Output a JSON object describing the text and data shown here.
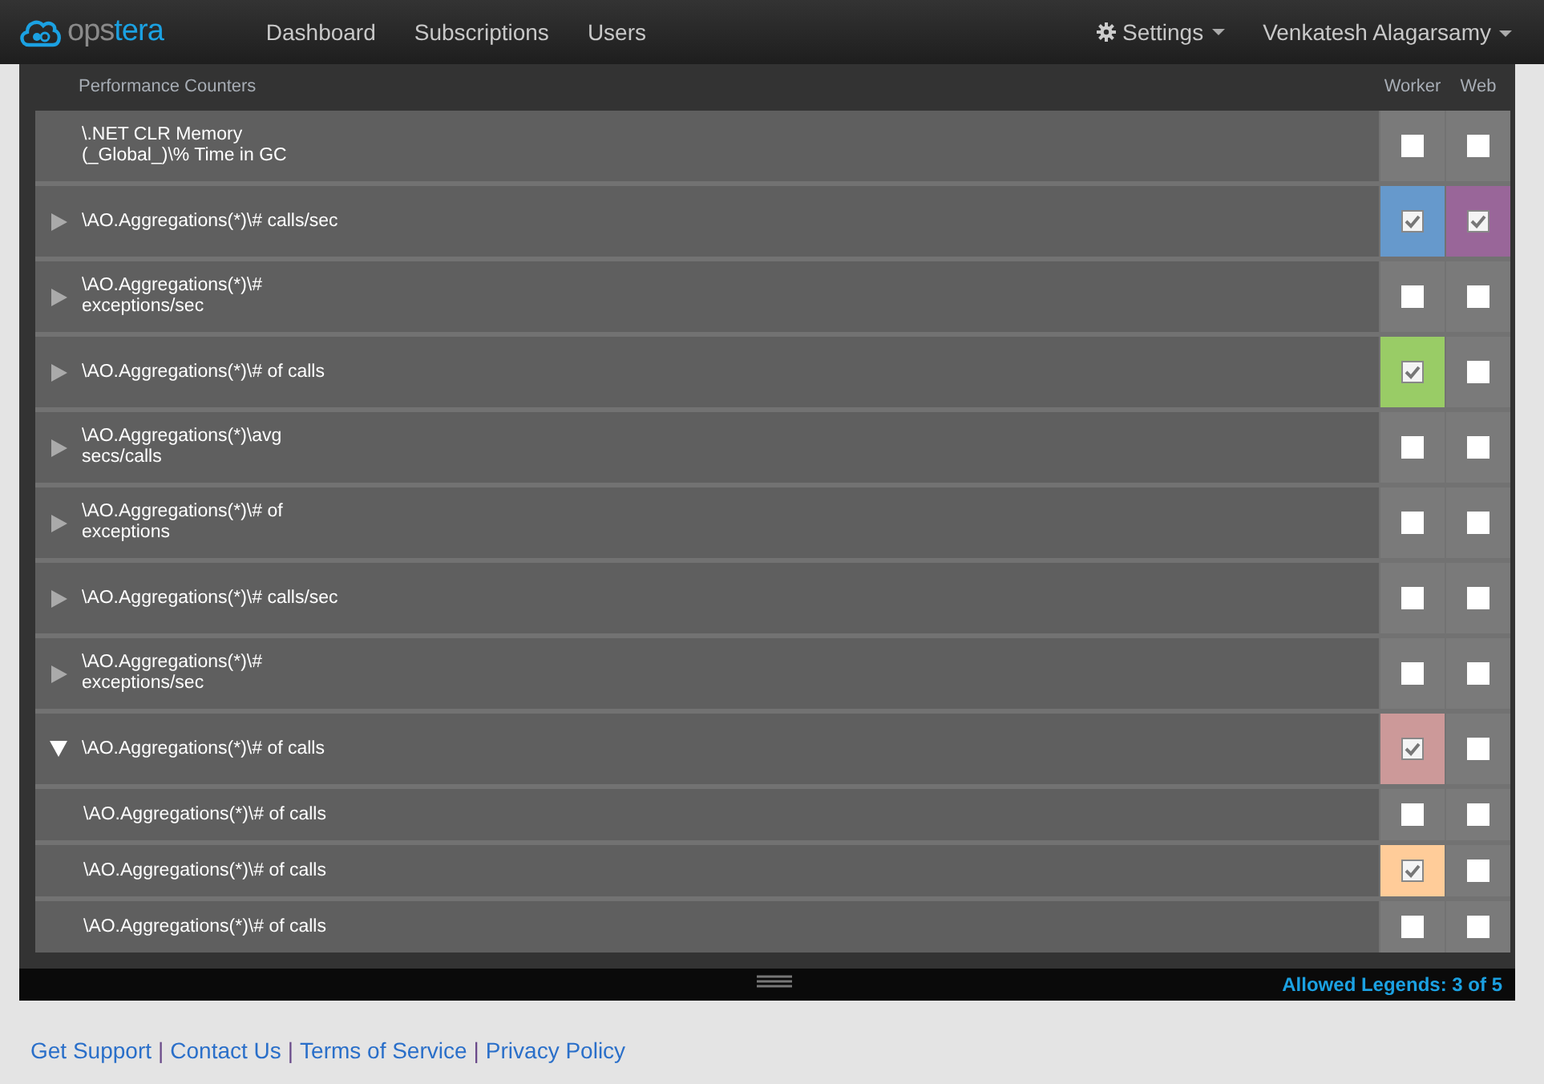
{
  "navbar": {
    "brand": [
      "ops",
      "tera"
    ],
    "links": [
      {
        "label": "Dashboard"
      },
      {
        "label": "Subscriptions"
      },
      {
        "label": "Users"
      }
    ],
    "settings": "Settings",
    "user": "Venkatesh Alagarsamy"
  },
  "panel": {
    "title": "Performance Counters",
    "columns": [
      "Worker",
      "Web"
    ],
    "counters": [
      {
        "name": "\\.NET CLR Memory (_Global_)\\% Time in GC",
        "worker": {
          "checked": false
        },
        "web": {
          "checked": false
        }
      },
      {
        "name": "\\AO.Aggregations(*)\\# calls/sec",
        "expanded": false,
        "worker": {
          "checked": true,
          "color": "#6699cc"
        },
        "web": {
          "checked": true,
          "color": "#996699"
        }
      },
      {
        "name": "\\AO.Aggregations(*)\\# exceptions/sec",
        "expanded": false,
        "worker": {
          "checked": false
        },
        "web": {
          "checked": false
        }
      },
      {
        "name": "\\AO.Aggregations(*)\\# of calls",
        "expanded": false,
        "worker": {
          "checked": true,
          "color": "#99cc66"
        },
        "web": {
          "checked": false
        }
      },
      {
        "name": "\\AO.Aggregations(*)\\avg secs/calls",
        "expanded": false,
        "worker": {
          "checked": false
        },
        "web": {
          "checked": false
        }
      },
      {
        "name": "\\AO.Aggregations(*)\\# of exceptions",
        "expanded": false,
        "worker": {
          "checked": false
        },
        "web": {
          "checked": false
        }
      },
      {
        "name": "\\AO.Aggregations(*)\\# calls/sec",
        "expanded": false,
        "worker": {
          "checked": false
        },
        "web": {
          "checked": false
        }
      },
      {
        "name": "\\AO.Aggregations(*)\\# exceptions/sec",
        "expanded": false,
        "worker": {
          "checked": false
        },
        "web": {
          "checked": false
        }
      },
      {
        "name": "\\AO.Aggregations(*)\\# of calls",
        "expanded": true,
        "worker": {
          "checked": true,
          "color": "#cc9999"
        },
        "web": {
          "checked": false
        },
        "children": [
          {
            "name": "\\AO.Aggregations(*)\\# of calls",
            "worker": {
              "checked": false
            },
            "web": {
              "checked": false
            }
          },
          {
            "name": "\\AO.Aggregations(*)\\# of calls",
            "worker": {
              "checked": true,
              "color": "#ffcc99"
            },
            "web": {
              "checked": false
            }
          },
          {
            "name": "\\AO.Aggregations(*)\\# of calls",
            "worker": {
              "checked": false
            },
            "web": {
              "checked": false
            }
          }
        ]
      }
    ],
    "status": "Allowed Legends: 3 of 5"
  },
  "footer": [
    {
      "kind": "link",
      "label": "Get Support"
    },
    {
      "kind": "separator",
      "label": "|"
    },
    {
      "kind": "link",
      "label": "Contact Us"
    },
    {
      "kind": "separator",
      "label": "|"
    },
    {
      "kind": "link",
      "label": "Terms of Service"
    },
    {
      "kind": "separator",
      "label": "|"
    },
    {
      "kind": "link",
      "label": "Privacy Policy"
    }
  ]
}
